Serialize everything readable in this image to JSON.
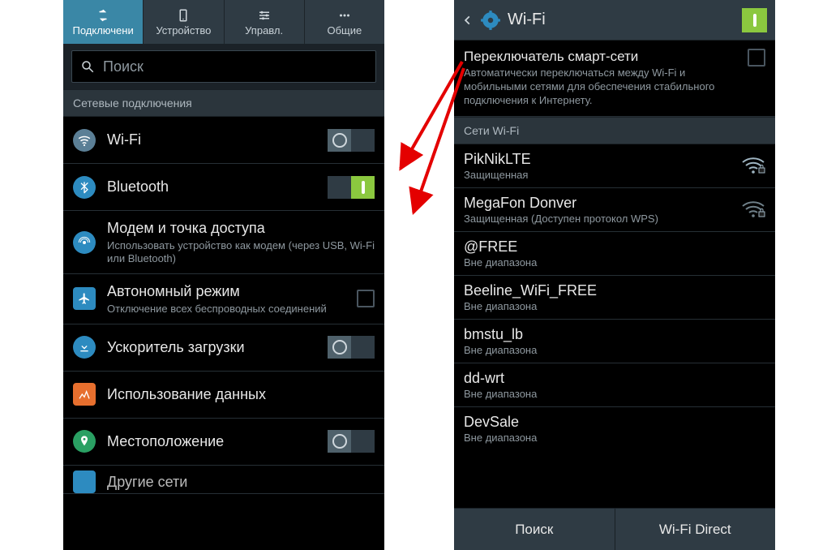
{
  "left": {
    "tabs": [
      {
        "label": "Подключени"
      },
      {
        "label": "Устройство"
      },
      {
        "label": "Управл."
      },
      {
        "label": "Общие"
      }
    ],
    "search_placeholder": "Поиск",
    "section_header": "Сетевые подключения",
    "rows": {
      "wifi": {
        "label": "Wi-Fi"
      },
      "bluetooth": {
        "label": "Bluetooth"
      },
      "tether": {
        "label": "Модем и точка доступа",
        "sub": "Использовать устройство как модем (через USB, Wi-Fi или Bluetooth)"
      },
      "airplane": {
        "label": "Автономный режим",
        "sub": "Отключение всех беспроводных соединений"
      },
      "booster": {
        "label": "Ускоритель загрузки"
      },
      "datausage": {
        "label": "Использование данных"
      },
      "location": {
        "label": "Местоположение"
      },
      "more": {
        "label": "Другие сети"
      }
    }
  },
  "right": {
    "header_title": "Wi-Fi",
    "smart": {
      "title": "Переключатель смарт-сети",
      "sub": "Автоматически переключаться между Wi-Fi и мобильными сетями для обеспечения стабильного подключения к Интернету."
    },
    "section_header": "Сети Wi-Fi",
    "networks": [
      {
        "ssid": "PikNikLTE",
        "status": "Защищенная",
        "signal": true,
        "locked": true
      },
      {
        "ssid": "MegaFon Donver",
        "status": "Защищенная (Доступен протокол WPS)",
        "signal": true,
        "locked": true
      },
      {
        "ssid": "@FREE",
        "status": "Вне диапазона",
        "signal": false
      },
      {
        "ssid": "Beeline_WiFi_FREE",
        "status": "Вне диапазона",
        "signal": false
      },
      {
        "ssid": "bmstu_lb",
        "status": "Вне диапазона",
        "signal": false
      },
      {
        "ssid": "dd-wrt",
        "status": "Вне диапазона",
        "signal": false
      },
      {
        "ssid": "DevSale",
        "status": "Вне диапазона",
        "signal": false
      }
    ],
    "buttons": {
      "scan": "Поиск",
      "direct": "Wi-Fi Direct"
    }
  },
  "colors": {
    "wifi": "#5b7f96",
    "bluetooth": "#2d8bc0",
    "tether": "#2d8bc0",
    "airplane": "#2d8bc0",
    "booster": "#2d8bc0",
    "datausage": "#e76f2e",
    "location": "#2aa063"
  }
}
